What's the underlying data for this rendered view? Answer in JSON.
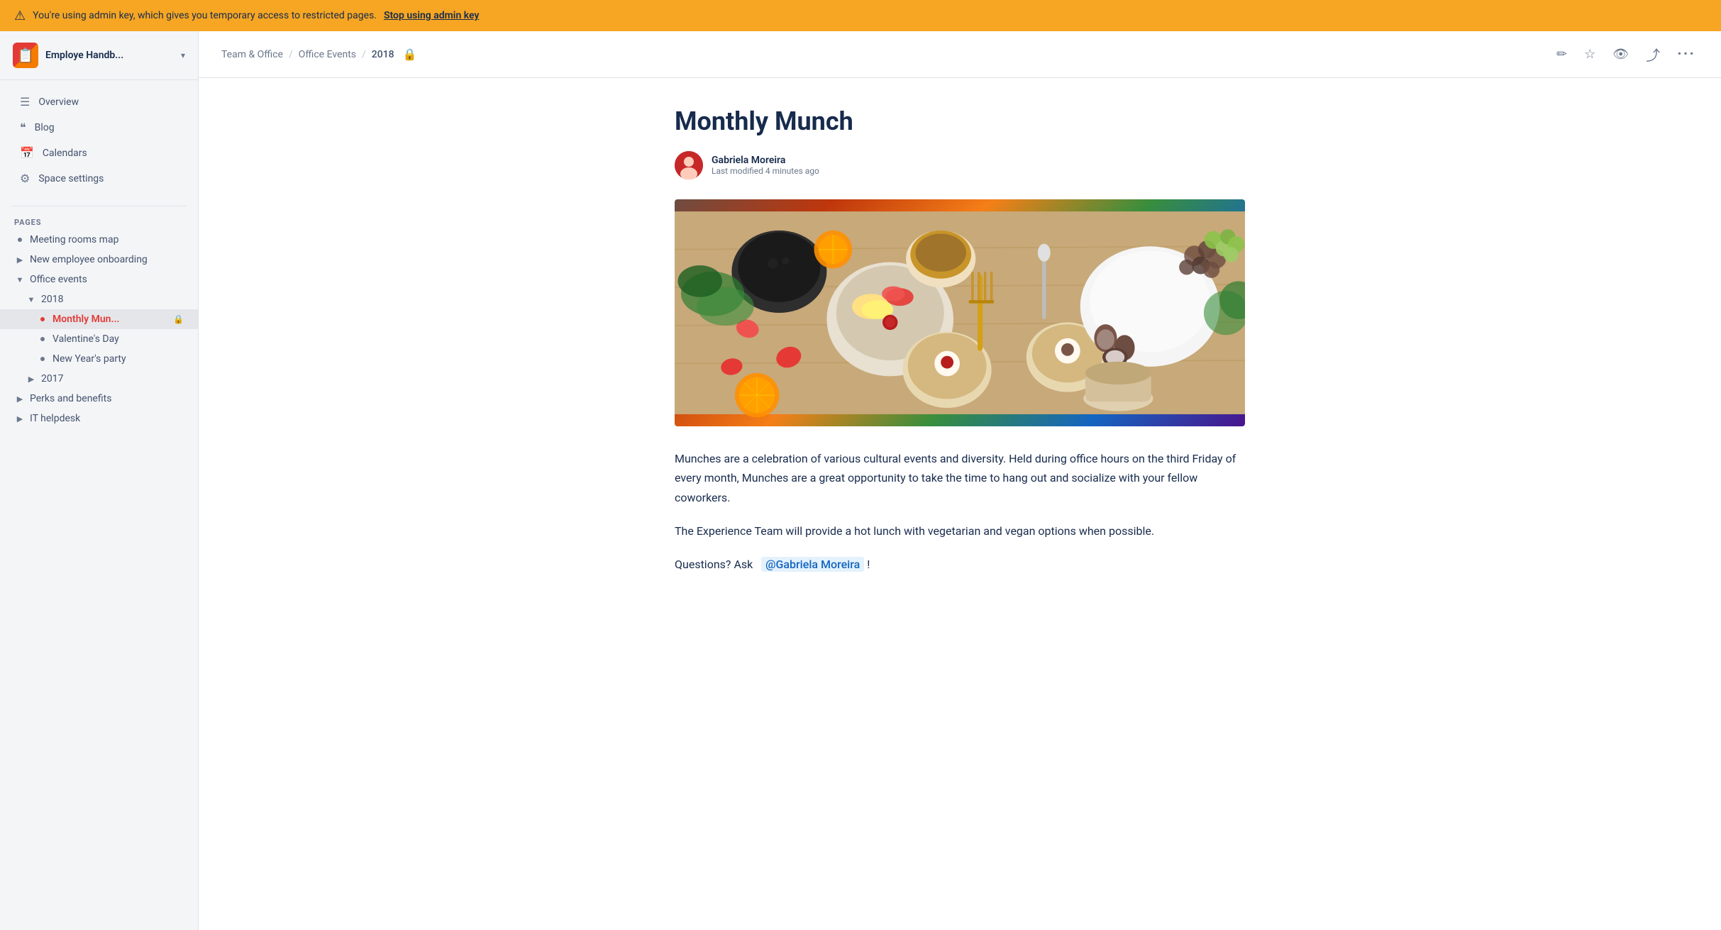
{
  "banner": {
    "text": "You're using admin key, which gives you temporary access to restricted pages.",
    "link_text": "Stop using admin key",
    "icon": "⚠"
  },
  "sidebar": {
    "logo_icon": "📋",
    "title": "Employe Handb...",
    "chevron": "▾",
    "nav_items": [
      {
        "id": "overview",
        "icon": "☰",
        "label": "Overview"
      },
      {
        "id": "blog",
        "icon": "❝",
        "label": "Blog"
      },
      {
        "id": "calendars",
        "icon": "📅",
        "label": "Calendars"
      },
      {
        "id": "space-settings",
        "icon": "⚙",
        "label": "Space settings"
      }
    ],
    "pages_label": "PAGES",
    "tree": [
      {
        "id": "meeting-rooms",
        "level": 1,
        "prefix": "bullet",
        "label": "Meeting rooms map"
      },
      {
        "id": "new-employee",
        "level": 1,
        "prefix": "toggle",
        "toggle": "▶",
        "label": "New employee onboarding"
      },
      {
        "id": "office-events",
        "level": 1,
        "prefix": "toggle",
        "toggle": "▼",
        "label": "Office events",
        "open": true
      },
      {
        "id": "2018",
        "level": 2,
        "prefix": "toggle",
        "toggle": "▼",
        "label": "2018",
        "open": true
      },
      {
        "id": "monthly-munch",
        "level": 3,
        "prefix": "bullet",
        "label": "Monthly Mun...",
        "active": true,
        "locked": true
      },
      {
        "id": "valentines-day",
        "level": 3,
        "prefix": "bullet",
        "label": "Valentine's Day"
      },
      {
        "id": "new-years-party",
        "level": 3,
        "prefix": "bullet",
        "label": "New Year's party"
      },
      {
        "id": "2017",
        "level": 2,
        "prefix": "toggle",
        "toggle": "▶",
        "label": "2017"
      },
      {
        "id": "perks-benefits",
        "level": 1,
        "prefix": "toggle",
        "toggle": "▶",
        "label": "Perks and benefits"
      },
      {
        "id": "it-helpdesk",
        "level": 1,
        "prefix": "toggle",
        "toggle": "▶",
        "label": "IT helpdesk"
      }
    ]
  },
  "topbar": {
    "breadcrumb": [
      {
        "id": "team-office",
        "label": "Team & Office"
      },
      {
        "id": "office-events",
        "label": "Office Events"
      },
      {
        "id": "year-2018",
        "label": "2018"
      }
    ],
    "lock_icon": "🔒",
    "actions": [
      {
        "id": "edit",
        "icon": "✏"
      },
      {
        "id": "star",
        "icon": "☆"
      },
      {
        "id": "view",
        "icon": "👁"
      },
      {
        "id": "share",
        "icon": "⤴"
      },
      {
        "id": "more",
        "icon": "⋯"
      }
    ]
  },
  "page": {
    "title": "Monthly Munch",
    "author": {
      "name": "Gabriela Moreira",
      "meta": "Last modified 4 minutes ago"
    },
    "paragraphs": [
      "Munches are a celebration of various cultural events and diversity. Held during office hours on the third Friday of every month, Munches are a great opportunity to take the time to hang out and socialize with your fellow coworkers.",
      "The Experience Team will provide a hot lunch with vegetarian and vegan options when possible.",
      "Questions? Ask"
    ],
    "mention": "@Gabriela Moreira",
    "mention_suffix": "!"
  }
}
